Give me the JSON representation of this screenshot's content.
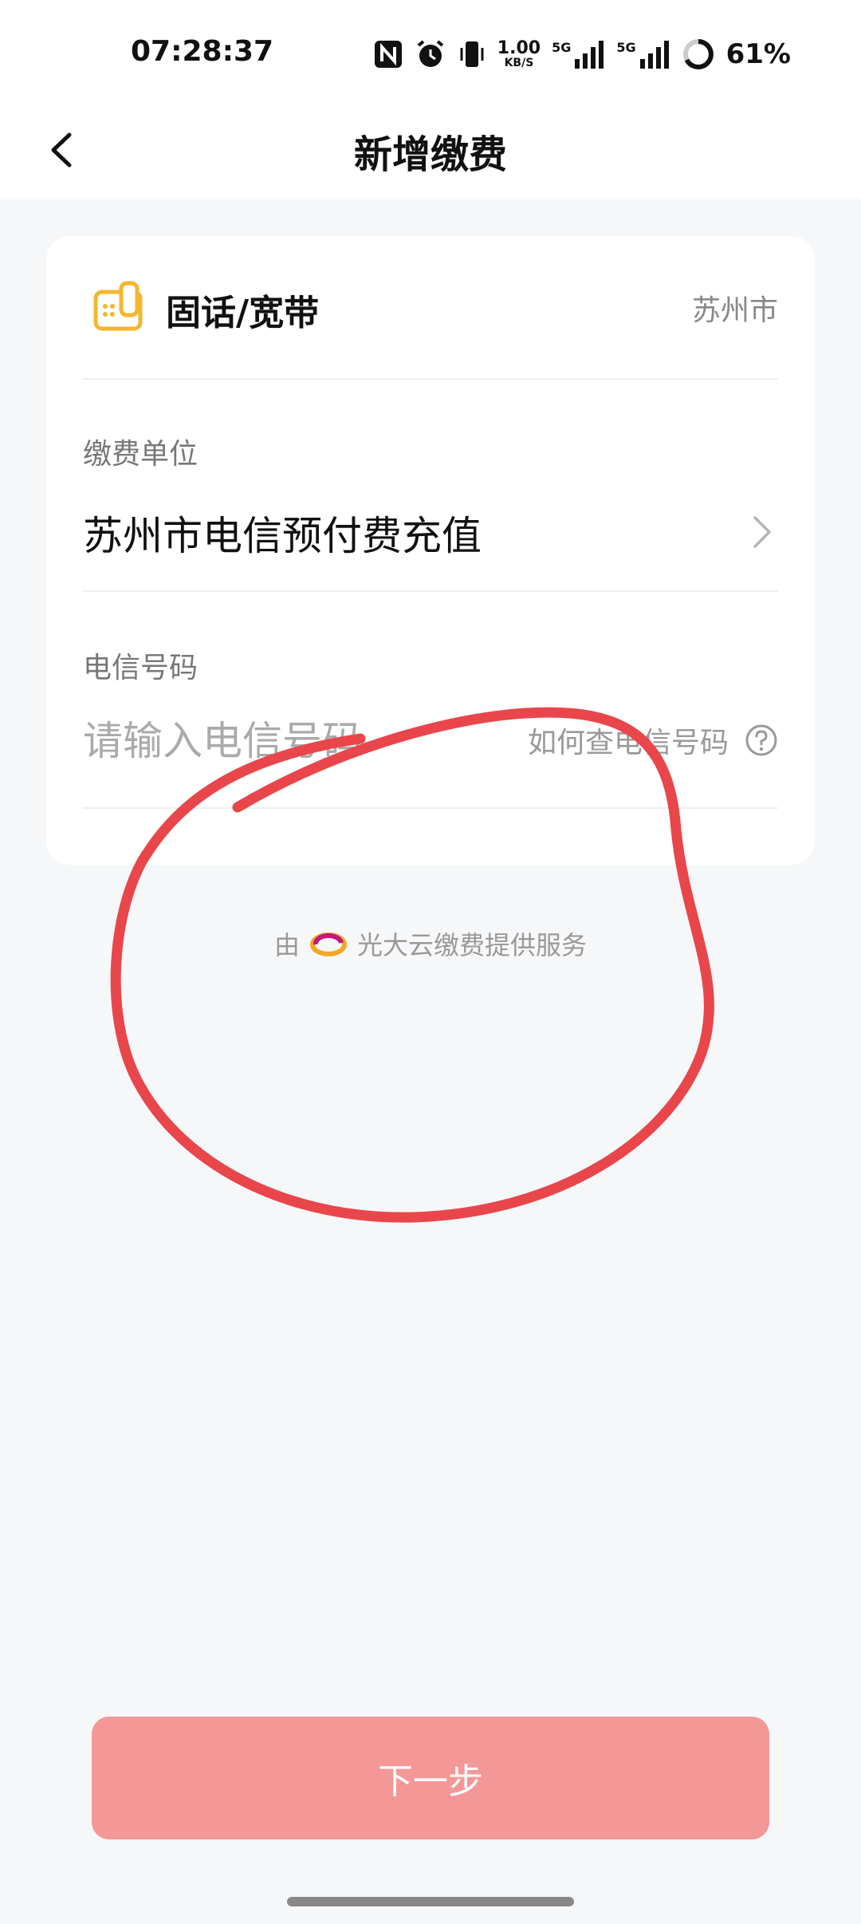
{
  "status_bar": {
    "time": "07:28:37",
    "net_speed_value": "1.00",
    "net_speed_unit": "KB/S",
    "signal_1_label": "5G",
    "signal_2_label": "5G",
    "battery_percent": "61%",
    "icons": [
      "nfc-icon",
      "alarm-icon",
      "vibrate-icon",
      "signal-icon",
      "battery-icon"
    ]
  },
  "header": {
    "title": "新增缴费",
    "back_icon": "chevron-left-icon"
  },
  "service": {
    "name": "固话/宽带",
    "city": "苏州市",
    "icon": "landline-phone-icon",
    "accent_color": "#f5b62e"
  },
  "fields": {
    "unit_label": "缴费单位",
    "unit_value": "苏州市电信预付费充值",
    "phone_label": "电信号码",
    "phone_placeholder": "请输入电信号码",
    "phone_value": "",
    "help_text": "如何查电信号码"
  },
  "provider": {
    "prefix": "由",
    "text": "光大云缴费提供服务",
    "icon": "cloud-logo-icon"
  },
  "next_button": {
    "label": "下一步",
    "color": "#f49797"
  },
  "annotation": {
    "color": "#e8464b"
  }
}
